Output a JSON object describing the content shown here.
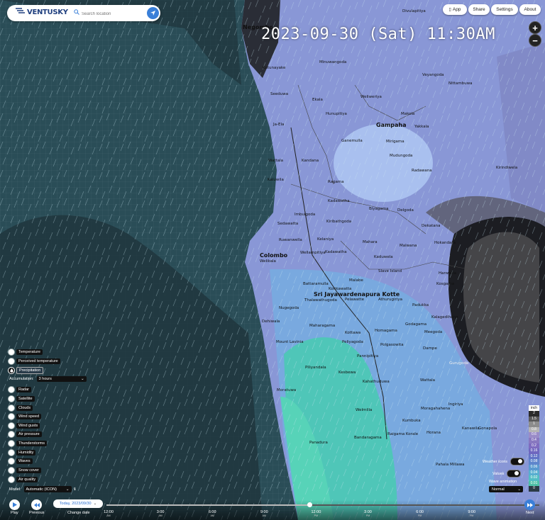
{
  "header": {
    "logo_text": "VENTUSKY",
    "search_placeholder": "Search location",
    "buttons": {
      "app": "App",
      "share": "Share",
      "settings": "Settings",
      "about": "About"
    }
  },
  "timestamp": "2023-09-30 (Sat) 11:30AM",
  "zoom": {
    "in": "+",
    "out": "−"
  },
  "map": {
    "places": [
      {
        "name": "Negombo",
        "big": true
      },
      {
        "name": "Gampaha",
        "big": true
      },
      {
        "name": "Colombo",
        "big": true
      },
      {
        "name": "Sri Jayawardenapura Kotte",
        "big": true
      },
      {
        "name": "Katunayake"
      },
      {
        "name": "Seeduwa"
      },
      {
        "name": "Ja-Ela"
      },
      {
        "name": "Kandana"
      },
      {
        "name": "Wattala"
      },
      {
        "name": "Kelaniya"
      },
      {
        "name": "Kadawatha"
      },
      {
        "name": "Kiribathgoda"
      },
      {
        "name": "Wellampitiya"
      },
      {
        "name": "Kaduwela"
      },
      {
        "name": "Malabe"
      },
      {
        "name": "Battaramulla"
      },
      {
        "name": "Homagama"
      },
      {
        "name": "Maharagama"
      },
      {
        "name": "Kottawa"
      },
      {
        "name": "Piliyandala"
      },
      {
        "name": "Moratuwa"
      },
      {
        "name": "Dehiwala"
      },
      {
        "name": "Mount Lavinia"
      },
      {
        "name": "Panadura"
      },
      {
        "name": "Horana"
      },
      {
        "name": "Bandaragama"
      },
      {
        "name": "Kesbewa"
      },
      {
        "name": "Nugegoda"
      },
      {
        "name": "Dekatana"
      },
      {
        "name": "Hanwella"
      },
      {
        "name": "Padukka"
      },
      {
        "name": "Meegoda"
      },
      {
        "name": "Minuwangoda"
      },
      {
        "name": "Divulapitiya"
      },
      {
        "name": "Nittambuwa"
      },
      {
        "name": "Veyangoda"
      },
      {
        "name": "Kirindiwela"
      },
      {
        "name": "Yakkala"
      },
      {
        "name": "Mirigama"
      },
      {
        "name": "Ingiriya"
      },
      {
        "name": "Ekala"
      },
      {
        "name": "Ragama"
      },
      {
        "name": "Delgoda"
      },
      {
        "name": "Ganemulla"
      },
      {
        "name": "Malwana"
      },
      {
        "name": "Biyagama"
      },
      {
        "name": "Thalawathugoda"
      },
      {
        "name": "Athurugiriya"
      },
      {
        "name": "Godagama"
      },
      {
        "name": "Polgasowita"
      },
      {
        "name": "Dampe"
      },
      {
        "name": "Pannipitiya"
      },
      {
        "name": "Kahathuduwa"
      },
      {
        "name": "Welmilla"
      },
      {
        "name": "Kumbuka"
      },
      {
        "name": "Raigama Korale"
      },
      {
        "name": "Gonapola"
      },
      {
        "name": "Kaluwila"
      },
      {
        "name": "Wattala"
      },
      {
        "name": "Moragahahena"
      },
      {
        "name": "Kanawila"
      },
      {
        "name": "Gurugoda"
      },
      {
        "name": "Pahala Millawa"
      },
      {
        "name": "Welikala"
      },
      {
        "name": "Slave Island"
      },
      {
        "name": "Kotikawatta"
      },
      {
        "name": "Pelawatte"
      },
      {
        "name": "Hokandara"
      },
      {
        "name": "Kosgama"
      },
      {
        "name": "Ruwanwella"
      },
      {
        "name": "Sedawatta"
      },
      {
        "name": "Peliyagoda"
      },
      {
        "name": "Hunupitiya"
      },
      {
        "name": "Makola"
      },
      {
        "name": "Mudungoda"
      },
      {
        "name": "Radawana"
      },
      {
        "name": "Weliweriya"
      },
      {
        "name": "Imbulgoda"
      },
      {
        "name": "Kadawatha"
      },
      {
        "name": "Mahara"
      },
      {
        "name": "Kalagedihena"
      },
      {
        "name": "Pugoda"
      }
    ]
  },
  "layers": {
    "items": [
      {
        "label": "Temperature"
      },
      {
        "label": "Perceived temperature"
      },
      {
        "label": "Precipitation",
        "active": true
      },
      {
        "label": "Radar"
      },
      {
        "label": "Satellite"
      },
      {
        "label": "Clouds"
      },
      {
        "label": "Wind speed"
      },
      {
        "label": "Wind gusts"
      },
      {
        "label": "Air pressure"
      },
      {
        "label": "Thunderstorms"
      },
      {
        "label": "Humidity"
      },
      {
        "label": "Waves"
      },
      {
        "label": "Snow cover"
      },
      {
        "label": "Air quality"
      }
    ],
    "accumulation_label": "Accumulation:",
    "accumulation_value": "3 hours",
    "model_label": "Model:",
    "model_value": "Automatic (ICON)"
  },
  "timeline": {
    "play": "Play",
    "previous": "Previous",
    "change_date": "Change date",
    "next": "Next",
    "today": "Today, 2023/09/30",
    "ticks": [
      {
        "time": "12:00",
        "sub": "AM"
      },
      {
        "time": "3:00",
        "sub": "AM"
      },
      {
        "time": "6:00",
        "sub": "AM"
      },
      {
        "time": "9:00",
        "sub": "AM"
      },
      {
        "time": "12:00",
        "sub": "PM"
      },
      {
        "time": "3:00",
        "sub": "PM"
      },
      {
        "time": "6:00",
        "sub": "PM"
      },
      {
        "time": "9:00",
        "sub": "PM"
      }
    ],
    "progress": 0.47
  },
  "legend": {
    "unit": "inch",
    "values": [
      "2",
      "1.5",
      "1",
      "0.8",
      "0.6",
      "0.4",
      "0.2",
      "0.16",
      "0.12",
      "0.08",
      "0.06",
      "0.04",
      "0.02",
      "0.01",
      "0"
    ],
    "colors": [
      "#2a2a2a",
      "#5a5a5a",
      "#8c8c8c",
      "#b4b4b4",
      "#9a8cc8",
      "#8878c0",
      "#7e6cc0",
      "#6f67bf",
      "#6374c6",
      "#5f86cc",
      "#5a9ad0",
      "#58aed0",
      "#52bdc4",
      "#4fc0a8",
      "#2b3a46"
    ]
  },
  "controls": {
    "weather_icons": "Weather icons",
    "values": "Values",
    "wave_animation": "Wave animation",
    "wave_value": "Normal"
  },
  "colors": {
    "accent": "#3a7fd8",
    "sea": "#2d5b66",
    "land_light": "#8b9bd6",
    "land_dark": "#5a5c7a",
    "rain_core": "#a8c2f0"
  }
}
